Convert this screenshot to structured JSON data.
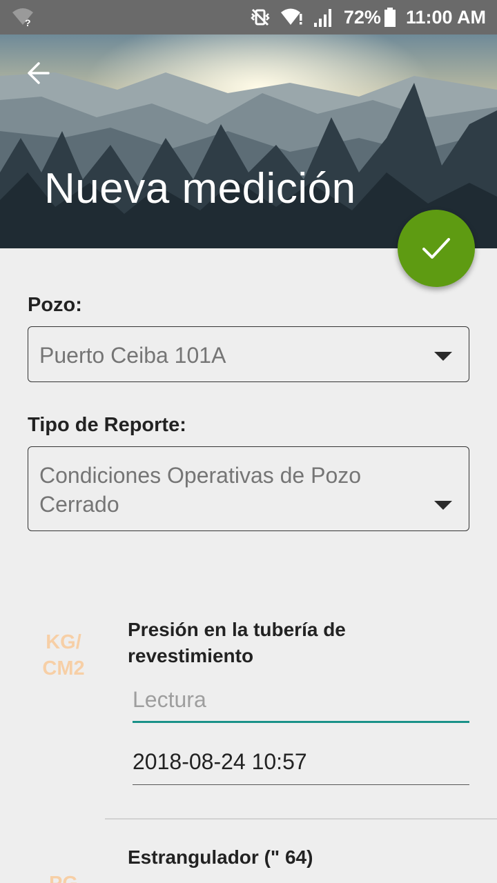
{
  "status_bar": {
    "battery": "72%",
    "time": "11:00 AM",
    "icons": [
      "wifi-unknown-icon",
      "vibrate-off-icon",
      "wifi-icon",
      "signal-icon",
      "battery-icon"
    ]
  },
  "header": {
    "title": "Nueva medición",
    "back_icon": "arrow-back-icon",
    "confirm_icon": "check-icon",
    "confirm_color": "#5e9b12"
  },
  "form": {
    "well_label": "Pozo:",
    "well_value": "Puerto Ceiba 101A",
    "report_label": "Tipo de Reporte:",
    "report_value_line1": "Condiciones Operativas de Pozo",
    "report_value_line2": "Cerrado"
  },
  "measurements": [
    {
      "unit_line1": "KG/",
      "unit_line2": "CM2",
      "label_line1": "Presión en la tubería de",
      "label_line2": "revestimiento",
      "reading_placeholder": "Lectura",
      "datetime": "2018-08-24 10:57"
    },
    {
      "unit_line1": "PG",
      "label_line1": "Estrangulador (\" 64)"
    }
  ],
  "colors": {
    "accent": "#1a9188",
    "unit_text": "#f7cfa6"
  }
}
